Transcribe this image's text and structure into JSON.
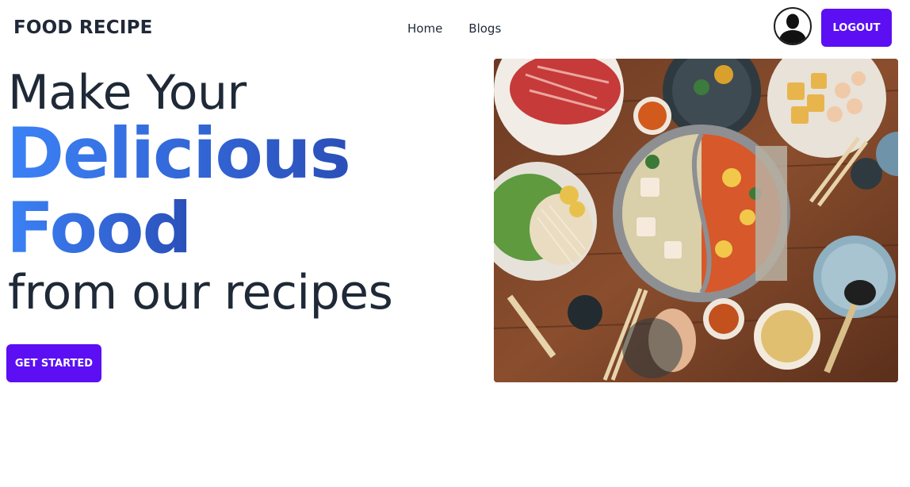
{
  "navbar": {
    "brand": "FOOD RECIPE",
    "links": [
      {
        "label": "Home"
      },
      {
        "label": "Blogs"
      }
    ],
    "logout_label": "LOGOUT",
    "avatar_icon": "user-avatar-icon"
  },
  "hero": {
    "line1": "Make Your",
    "line2": "Delicious",
    "line3": "Food",
    "line4": "from our recipes",
    "cta_label": "GET STARTED",
    "image_subject": "hot-pot-food-spread"
  },
  "colors": {
    "accent": "#5b0ff2",
    "gradient_start": "#3b82f6",
    "gradient_end": "#2b4fb8",
    "text_dark": "#1f2937"
  }
}
